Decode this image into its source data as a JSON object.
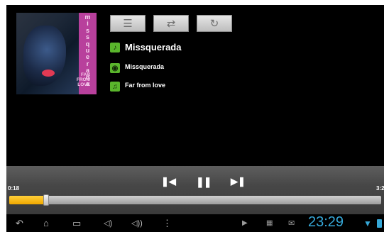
{
  "album_art": {
    "vertical_title": "missquerada",
    "subtitle_lines": [
      "FAR",
      "FROM",
      "LOVE"
    ]
  },
  "toolbar": {
    "list_icon": "list-icon",
    "shuffle_icon": "shuffle-icon",
    "repeat_icon": "repeat-icon"
  },
  "track": {
    "title": "Missquerada",
    "artist": "Missquerada",
    "album": "Far from love"
  },
  "playback": {
    "elapsed": "0:18",
    "total": "3:2",
    "progress_fraction": 0.1
  },
  "system_bar": {
    "clock": "23:29"
  },
  "colors": {
    "accent_green": "#5ab52c",
    "progress_yellow": "#f0a800",
    "status_blue": "#36a8d8"
  }
}
